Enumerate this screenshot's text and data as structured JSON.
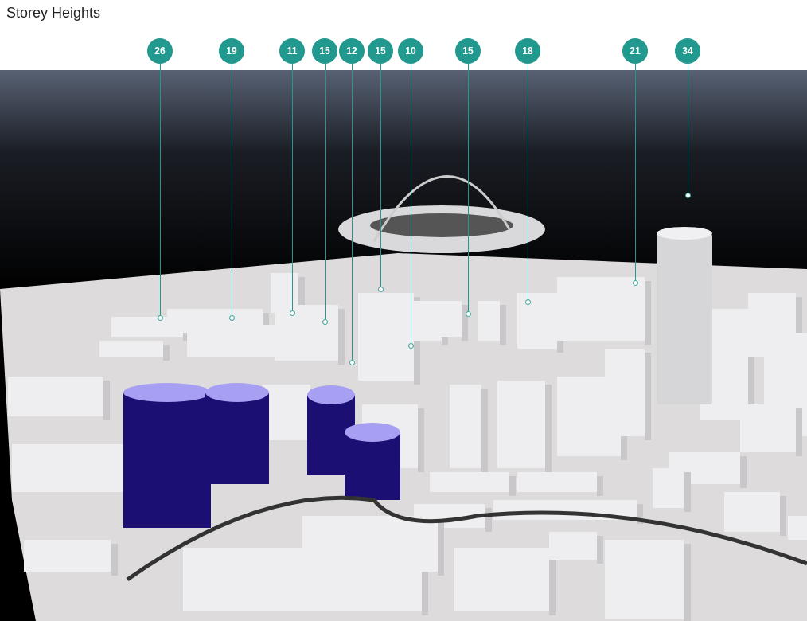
{
  "title": "Storey Heights",
  "labels": [
    {
      "storeys": "26"
    },
    {
      "storeys": "19"
    },
    {
      "storeys": "11"
    },
    {
      "storeys": "15"
    },
    {
      "storeys": "12"
    },
    {
      "storeys": "15"
    },
    {
      "storeys": "10"
    },
    {
      "storeys": "15"
    },
    {
      "storeys": "18"
    },
    {
      "storeys": "21"
    },
    {
      "storeys": "34"
    }
  ]
}
